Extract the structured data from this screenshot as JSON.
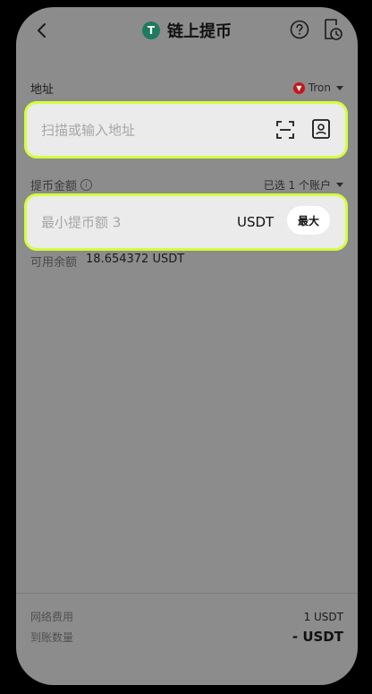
{
  "header": {
    "title": "链上提币",
    "coin_icon_glyph": "T"
  },
  "address": {
    "label": "地址",
    "network": "Tron",
    "placeholder": "扫描或输入地址"
  },
  "amount": {
    "label": "提币金额",
    "info_glyph": "i",
    "account_selector": "已选 1 个账户",
    "placeholder": "最小提币额 3",
    "unit": "USDT",
    "max_label": "最大"
  },
  "available": {
    "label": "可用余额",
    "value": "18.654372 USDT"
  },
  "footer": {
    "fee_label": "网络费用",
    "fee_value": "1 USDT",
    "receive_label": "到账数量",
    "receive_value": "- USDT"
  },
  "colors": {
    "overlay_background": "#8c8c8c",
    "highlight_border": "#d4ff3f",
    "field_background": "#ebebeb",
    "coin_green": "#1f7a5e",
    "tron_red": "#c4161c"
  }
}
